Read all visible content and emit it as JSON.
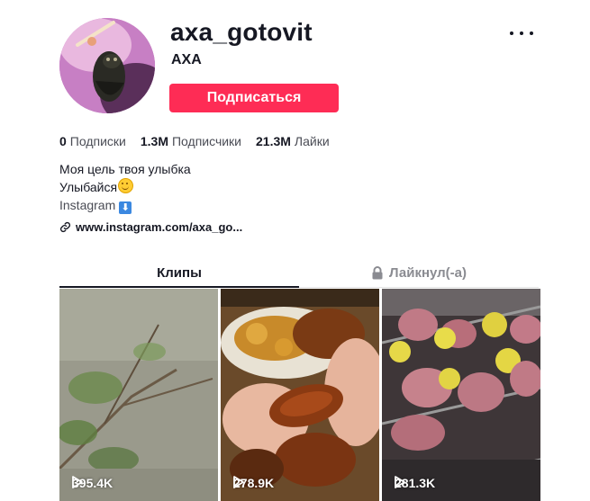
{
  "profile": {
    "username": "axa_gotovit",
    "nickname": "AXA",
    "follow_label": "Подписаться",
    "more_icon": "more-horizontal-icon"
  },
  "stats": {
    "following_count": "0",
    "following_label": "Подписки",
    "followers_count": "1.3M",
    "followers_label": "Подписчики",
    "likes_count": "21.3M",
    "likes_label": "Лайки"
  },
  "bio": {
    "line1": "Моя цель твоя улыбка",
    "line2": "Улыбайся",
    "line3": "Instagram",
    "line3_arrow": "⬇"
  },
  "link": {
    "text": "www.instagram.com/axa_go...",
    "icon": "link-icon"
  },
  "tabs": {
    "clips": "Клипы",
    "liked": "Лайкнул(-а)",
    "liked_icon": "lock-icon"
  },
  "videos": [
    {
      "views": "395.4K"
    },
    {
      "views": "278.9K"
    },
    {
      "views": "281.3K"
    }
  ],
  "colors": {
    "accent": "#fe2c55",
    "text": "#161823"
  }
}
